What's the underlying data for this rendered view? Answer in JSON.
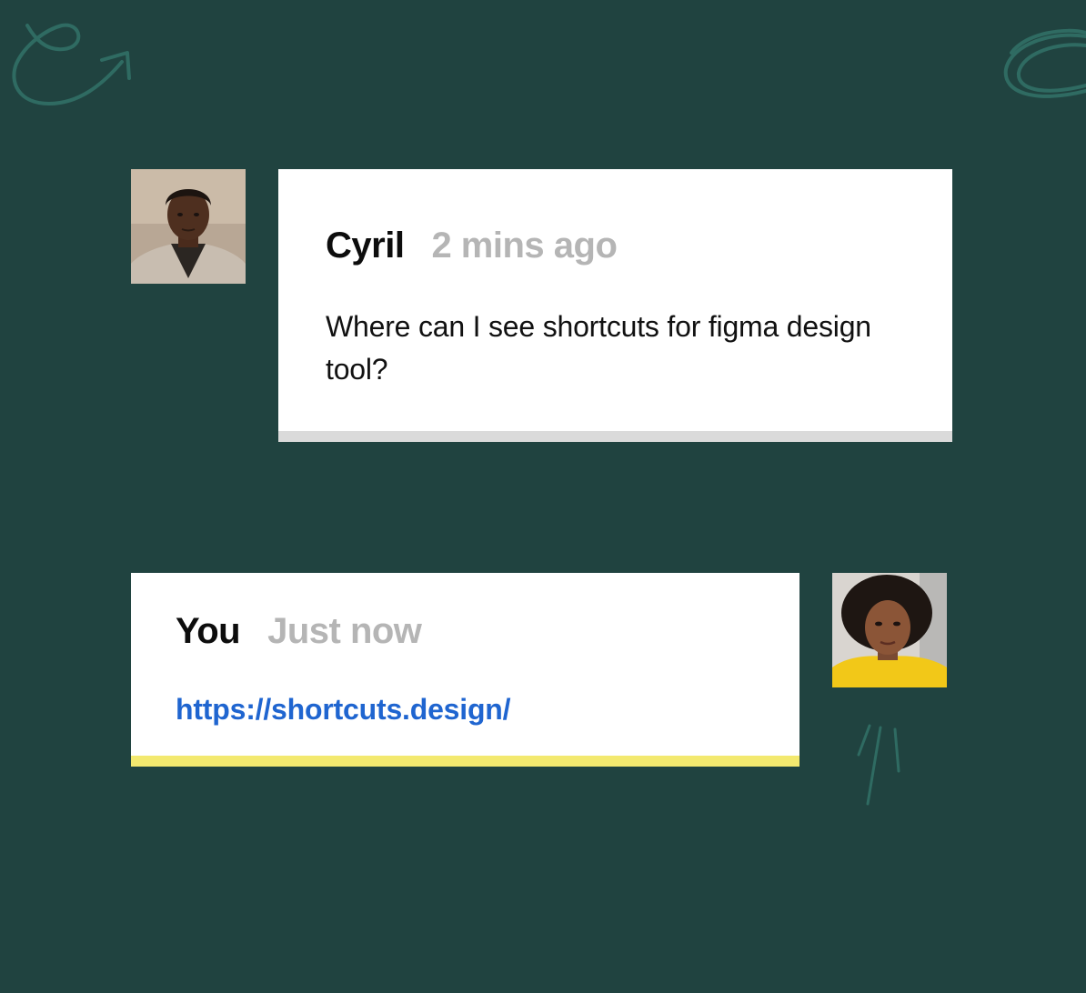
{
  "colors": {
    "background": "#204340",
    "doodle": "#2f6b62",
    "bubble": "#ffffff",
    "incoming_bar": "#dadada",
    "outgoing_bar": "#f3e96f",
    "author_text": "#0d0d0d",
    "time_text": "#b5b5b5",
    "link": "#1f65d0"
  },
  "messages": [
    {
      "author": "Cyril",
      "time": "2 mins ago",
      "text": "Where can I see shortcuts for figma design tool?",
      "avatar": "avatar-photo-cyril",
      "accent": "incoming_bar"
    },
    {
      "author": "You",
      "time": "Just now",
      "link": "https://shortcuts.design/",
      "avatar": "avatar-photo-user",
      "accent": "outgoing_bar"
    }
  ],
  "decorations": [
    "swirl-arrow-doodle",
    "scribble-circle-doodle",
    "spark-lines-doodle"
  ]
}
